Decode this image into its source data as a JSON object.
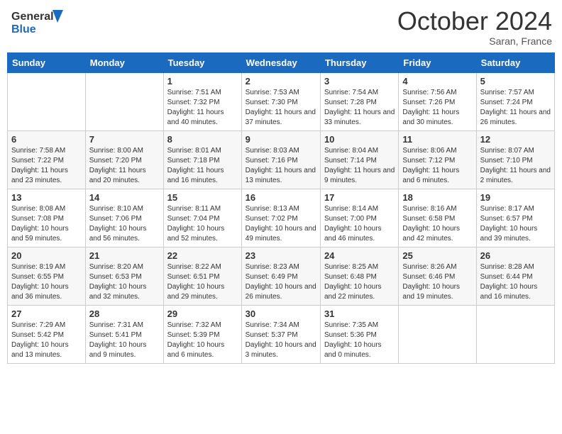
{
  "header": {
    "logo_line1": "General",
    "logo_line2": "Blue",
    "month_title": "October 2024",
    "subtitle": "Saran, France"
  },
  "days_of_week": [
    "Sunday",
    "Monday",
    "Tuesday",
    "Wednesday",
    "Thursday",
    "Friday",
    "Saturday"
  ],
  "weeks": [
    [
      {
        "day": "",
        "sunrise": "",
        "sunset": "",
        "daylight": ""
      },
      {
        "day": "",
        "sunrise": "",
        "sunset": "",
        "daylight": ""
      },
      {
        "day": "1",
        "sunrise": "Sunrise: 7:51 AM",
        "sunset": "Sunset: 7:32 PM",
        "daylight": "Daylight: 11 hours and 40 minutes."
      },
      {
        "day": "2",
        "sunrise": "Sunrise: 7:53 AM",
        "sunset": "Sunset: 7:30 PM",
        "daylight": "Daylight: 11 hours and 37 minutes."
      },
      {
        "day": "3",
        "sunrise": "Sunrise: 7:54 AM",
        "sunset": "Sunset: 7:28 PM",
        "daylight": "Daylight: 11 hours and 33 minutes."
      },
      {
        "day": "4",
        "sunrise": "Sunrise: 7:56 AM",
        "sunset": "Sunset: 7:26 PM",
        "daylight": "Daylight: 11 hours and 30 minutes."
      },
      {
        "day": "5",
        "sunrise": "Sunrise: 7:57 AM",
        "sunset": "Sunset: 7:24 PM",
        "daylight": "Daylight: 11 hours and 26 minutes."
      }
    ],
    [
      {
        "day": "6",
        "sunrise": "Sunrise: 7:58 AM",
        "sunset": "Sunset: 7:22 PM",
        "daylight": "Daylight: 11 hours and 23 minutes."
      },
      {
        "day": "7",
        "sunrise": "Sunrise: 8:00 AM",
        "sunset": "Sunset: 7:20 PM",
        "daylight": "Daylight: 11 hours and 20 minutes."
      },
      {
        "day": "8",
        "sunrise": "Sunrise: 8:01 AM",
        "sunset": "Sunset: 7:18 PM",
        "daylight": "Daylight: 11 hours and 16 minutes."
      },
      {
        "day": "9",
        "sunrise": "Sunrise: 8:03 AM",
        "sunset": "Sunset: 7:16 PM",
        "daylight": "Daylight: 11 hours and 13 minutes."
      },
      {
        "day": "10",
        "sunrise": "Sunrise: 8:04 AM",
        "sunset": "Sunset: 7:14 PM",
        "daylight": "Daylight: 11 hours and 9 minutes."
      },
      {
        "day": "11",
        "sunrise": "Sunrise: 8:06 AM",
        "sunset": "Sunset: 7:12 PM",
        "daylight": "Daylight: 11 hours and 6 minutes."
      },
      {
        "day": "12",
        "sunrise": "Sunrise: 8:07 AM",
        "sunset": "Sunset: 7:10 PM",
        "daylight": "Daylight: 11 hours and 2 minutes."
      }
    ],
    [
      {
        "day": "13",
        "sunrise": "Sunrise: 8:08 AM",
        "sunset": "Sunset: 7:08 PM",
        "daylight": "Daylight: 10 hours and 59 minutes."
      },
      {
        "day": "14",
        "sunrise": "Sunrise: 8:10 AM",
        "sunset": "Sunset: 7:06 PM",
        "daylight": "Daylight: 10 hours and 56 minutes."
      },
      {
        "day": "15",
        "sunrise": "Sunrise: 8:11 AM",
        "sunset": "Sunset: 7:04 PM",
        "daylight": "Daylight: 10 hours and 52 minutes."
      },
      {
        "day": "16",
        "sunrise": "Sunrise: 8:13 AM",
        "sunset": "Sunset: 7:02 PM",
        "daylight": "Daylight: 10 hours and 49 minutes."
      },
      {
        "day": "17",
        "sunrise": "Sunrise: 8:14 AM",
        "sunset": "Sunset: 7:00 PM",
        "daylight": "Daylight: 10 hours and 46 minutes."
      },
      {
        "day": "18",
        "sunrise": "Sunrise: 8:16 AM",
        "sunset": "Sunset: 6:58 PM",
        "daylight": "Daylight: 10 hours and 42 minutes."
      },
      {
        "day": "19",
        "sunrise": "Sunrise: 8:17 AM",
        "sunset": "Sunset: 6:57 PM",
        "daylight": "Daylight: 10 hours and 39 minutes."
      }
    ],
    [
      {
        "day": "20",
        "sunrise": "Sunrise: 8:19 AM",
        "sunset": "Sunset: 6:55 PM",
        "daylight": "Daylight: 10 hours and 36 minutes."
      },
      {
        "day": "21",
        "sunrise": "Sunrise: 8:20 AM",
        "sunset": "Sunset: 6:53 PM",
        "daylight": "Daylight: 10 hours and 32 minutes."
      },
      {
        "day": "22",
        "sunrise": "Sunrise: 8:22 AM",
        "sunset": "Sunset: 6:51 PM",
        "daylight": "Daylight: 10 hours and 29 minutes."
      },
      {
        "day": "23",
        "sunrise": "Sunrise: 8:23 AM",
        "sunset": "Sunset: 6:49 PM",
        "daylight": "Daylight: 10 hours and 26 minutes."
      },
      {
        "day": "24",
        "sunrise": "Sunrise: 8:25 AM",
        "sunset": "Sunset: 6:48 PM",
        "daylight": "Daylight: 10 hours and 22 minutes."
      },
      {
        "day": "25",
        "sunrise": "Sunrise: 8:26 AM",
        "sunset": "Sunset: 6:46 PM",
        "daylight": "Daylight: 10 hours and 19 minutes."
      },
      {
        "day": "26",
        "sunrise": "Sunrise: 8:28 AM",
        "sunset": "Sunset: 6:44 PM",
        "daylight": "Daylight: 10 hours and 16 minutes."
      }
    ],
    [
      {
        "day": "27",
        "sunrise": "Sunrise: 7:29 AM",
        "sunset": "Sunset: 5:42 PM",
        "daylight": "Daylight: 10 hours and 13 minutes."
      },
      {
        "day": "28",
        "sunrise": "Sunrise: 7:31 AM",
        "sunset": "Sunset: 5:41 PM",
        "daylight": "Daylight: 10 hours and 9 minutes."
      },
      {
        "day": "29",
        "sunrise": "Sunrise: 7:32 AM",
        "sunset": "Sunset: 5:39 PM",
        "daylight": "Daylight: 10 hours and 6 minutes."
      },
      {
        "day": "30",
        "sunrise": "Sunrise: 7:34 AM",
        "sunset": "Sunset: 5:37 PM",
        "daylight": "Daylight: 10 hours and 3 minutes."
      },
      {
        "day": "31",
        "sunrise": "Sunrise: 7:35 AM",
        "sunset": "Sunset: 5:36 PM",
        "daylight": "Daylight: 10 hours and 0 minutes."
      },
      {
        "day": "",
        "sunrise": "",
        "sunset": "",
        "daylight": ""
      },
      {
        "day": "",
        "sunrise": "",
        "sunset": "",
        "daylight": ""
      }
    ]
  ]
}
